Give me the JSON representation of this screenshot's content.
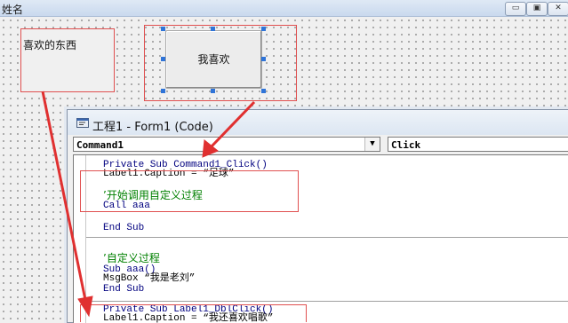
{
  "form_window": {
    "title": "姓名",
    "min_label": "▭",
    "max_label": "▣",
    "close_label": "✕"
  },
  "form": {
    "label1_caption": "喜欢的东西",
    "command1_caption": "我喜欢"
  },
  "code_window": {
    "title": "工程1 - Form1 (Code)",
    "object_combo": "Command1",
    "procedure_combo": "Click",
    "lines": [
      "Private Sub Command1_Click()",
      "Label1.Caption = “足球”",
      "’开始调用自定义过程",
      "Call aaa",
      "End Sub",
      "’自定义过程",
      "Sub aaa()",
      "MsgBox “我是老刘”",
      "End Sub",
      "Private Sub Label1_DblClick()",
      "Label1.Caption = “我还喜欢唱歌”"
    ]
  },
  "colors": {
    "annotation_red": "#e03030",
    "keyword_blue": "#00007f",
    "comment_green": "#008000"
  }
}
